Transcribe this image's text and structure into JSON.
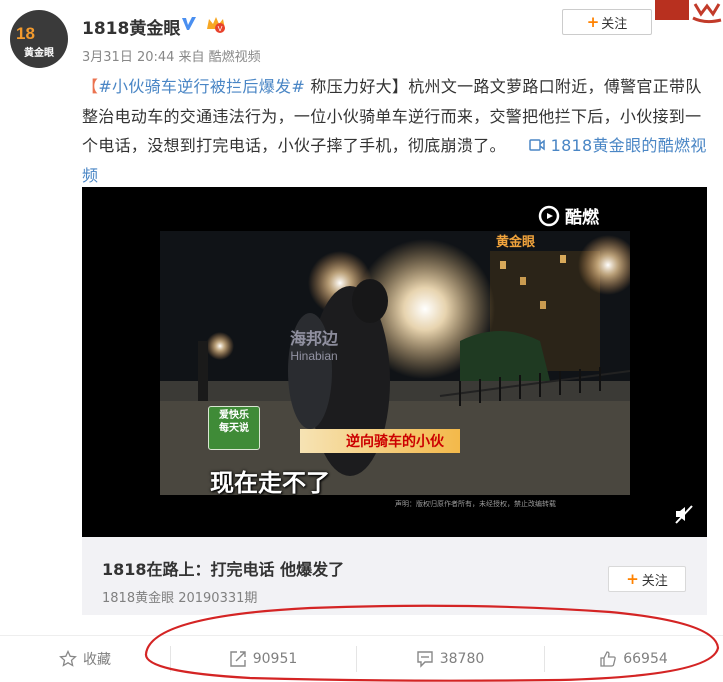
{
  "header": {
    "account_name": "1818黄金眼",
    "avatar_text_top": "18",
    "avatar_text_bottom": "黄金眼",
    "meta": "3月31日 20:44 来自 酷燃视频",
    "follow_label": "关注"
  },
  "post": {
    "topic": "#小伙骑车逆行被拦后爆发#",
    "text": " 称压力好大】杭州文一路文萝路口附近，傅警官正带队整治电动车的交通违法行为，一位小伙骑单车逆行而来，交警把他拦下后，小伙接到一个电话，没想到打完电话，小伙子摔了手机，彻底崩溃了。",
    "bracket_open": "【",
    "video_link": "1818黄金眼的酷燃视频"
  },
  "video": {
    "platform_logo": "酷燃",
    "watermark_cn": "海邦边",
    "watermark_en": "Hinabian",
    "caption_label": "逆向骑车的小伙",
    "subtitle": "现在走不了",
    "channel_badge": "黄金眼",
    "ad_text_1": "爱快乐",
    "ad_text_2": "每天说",
    "notice": "声明：版权归原作者所有，未经授权，禁止改编转载"
  },
  "card": {
    "title": "1818在路上：打完电话 他爆发了",
    "subtitle": "1818黄金眼 20190331期",
    "follow_label": "关注"
  },
  "actions": {
    "favorite_label": "收藏",
    "repost_count": "90951",
    "comment_count": "38780",
    "like_count": "66954"
  },
  "colors": {
    "accent_orange": "#ff8200",
    "topic_color": "#eb7350",
    "link_blue": "#4a86c5",
    "annotation_red": "#d42424"
  }
}
